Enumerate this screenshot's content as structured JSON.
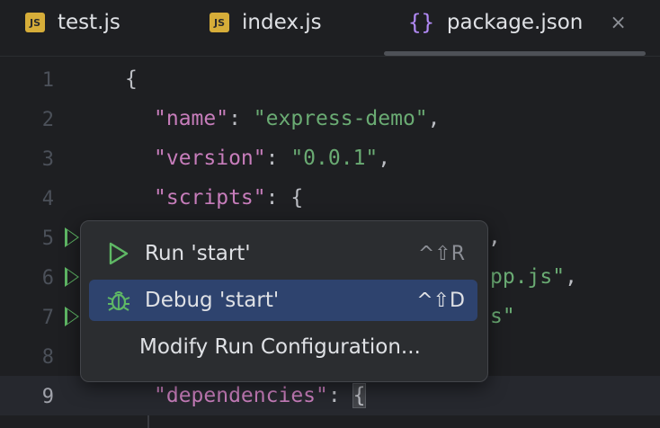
{
  "tabs": [
    {
      "label": "test.js",
      "icon": "js-file-icon",
      "icon_text": "JS"
    },
    {
      "label": "index.js",
      "icon": "js-file-icon",
      "icon_text": "JS"
    },
    {
      "label": "package.json",
      "icon": "json-file-icon",
      "icon_text": "{}",
      "active": true,
      "close": "×"
    }
  ],
  "editor": {
    "line_numbers": [
      "1",
      "2",
      "3",
      "4",
      "5",
      "6",
      "7",
      "8",
      "9"
    ],
    "current_line": "9",
    "lines": {
      "l1": {
        "brace": "{"
      },
      "l2": {
        "key": "\"name\"",
        "colon": ": ",
        "value": "\"express-demo\"",
        "comma": ","
      },
      "l3": {
        "key": "\"version\"",
        "colon": ": ",
        "value": "\"0.0.1\"",
        "comma": ","
      },
      "l4": {
        "key": "\"scripts\"",
        "colon": ": ",
        "brace": "{"
      },
      "l5": {
        "tail": ","
      },
      "l6": {
        "value_tail": "pp.js\"",
        "comma": ","
      },
      "l7": {
        "value_tail": "s\""
      },
      "l9": {
        "key": "\"dependencies\"",
        "colon": ": ",
        "brace": "{"
      }
    }
  },
  "popup": {
    "items": [
      {
        "label": "Run 'start'",
        "shortcut": "^⇧R",
        "icon": "run-icon"
      },
      {
        "label": "Debug 'start'",
        "shortcut": "^⇧D",
        "icon": "debug-icon",
        "selected": true
      },
      {
        "label": "Modify Run Configuration..."
      }
    ]
  },
  "colors": {
    "background": "#1e1f22",
    "key": "#c77dbb",
    "string": "#6aab73",
    "selection": "#2e436e",
    "run_green": "#5fb865"
  }
}
